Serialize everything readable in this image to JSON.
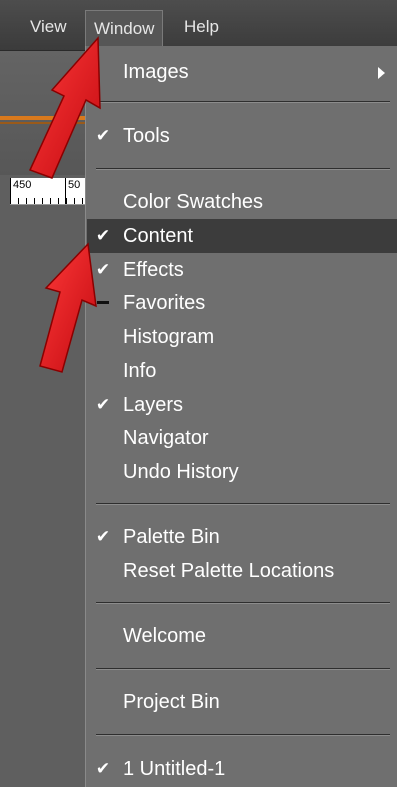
{
  "menubar": {
    "view": "View",
    "window": "Window",
    "help": "Help"
  },
  "ruler": {
    "label1": "450",
    "label2": "50"
  },
  "menu": {
    "items": [
      {
        "label": "Images",
        "checked": false,
        "submenu": true
      },
      {
        "label": "Tools",
        "checked": true
      },
      {
        "label": "Color Swatches",
        "checked": false
      },
      {
        "label": "Content",
        "checked": true,
        "highlighted": true
      },
      {
        "label": "Effects",
        "checked": true
      },
      {
        "label": "Favorites",
        "checked": false,
        "indeterminate": true
      },
      {
        "label": "Histogram",
        "checked": false
      },
      {
        "label": "Info",
        "checked": false
      },
      {
        "label": "Layers",
        "checked": true
      },
      {
        "label": "Navigator",
        "checked": false
      },
      {
        "label": "Undo History",
        "checked": false
      },
      {
        "label": "Palette Bin",
        "checked": true
      },
      {
        "label": "Reset Palette Locations",
        "checked": false
      },
      {
        "label": "Welcome",
        "checked": false
      },
      {
        "label": "Project Bin",
        "checked": false
      },
      {
        "label": "1 Untitled-1",
        "checked": true
      }
    ],
    "check_glyph": "✔"
  },
  "colors": {
    "annotation_arrow": "#e8141c",
    "highlight": "#3c3c3c",
    "orange_accent": "#d9791c"
  }
}
